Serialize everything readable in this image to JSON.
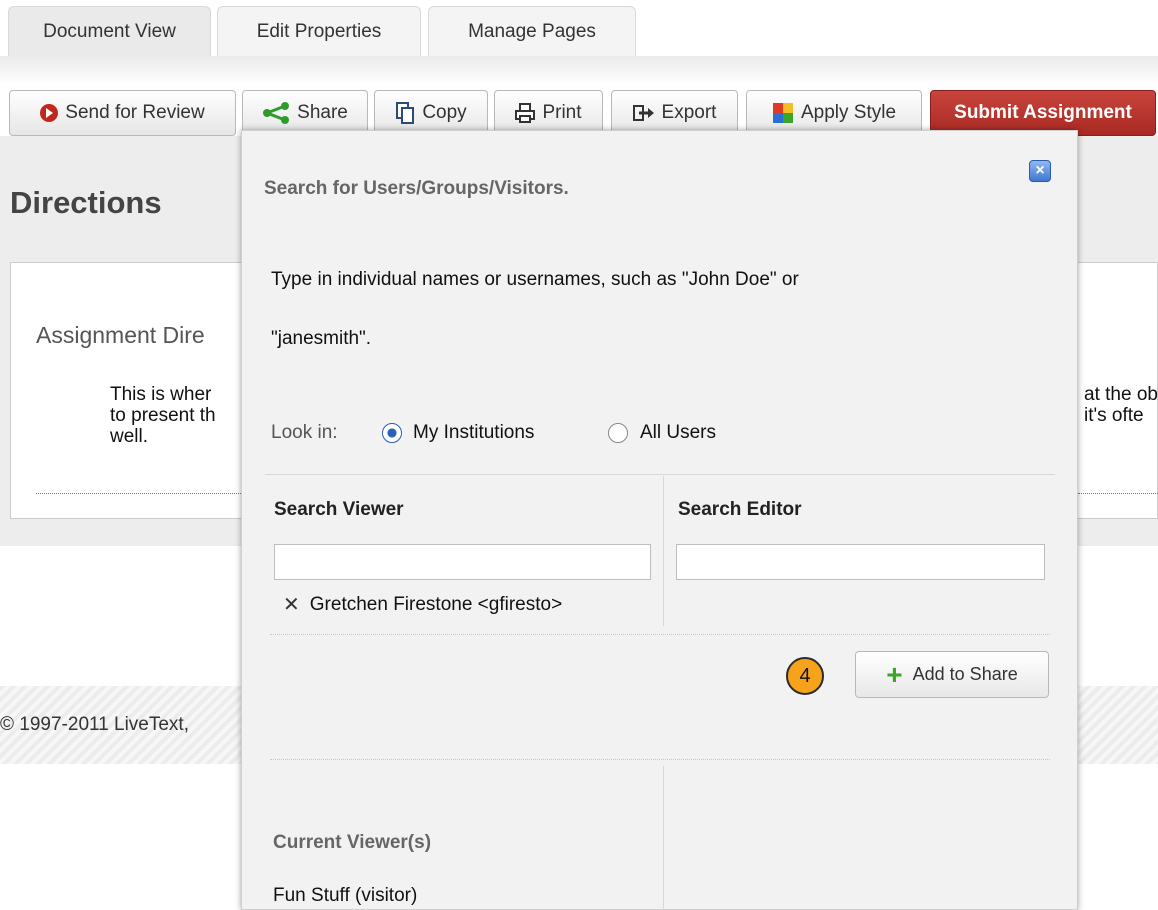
{
  "tabs": [
    "Document View",
    "Edit Properties",
    "Manage Pages"
  ],
  "toolbar": {
    "send_for_review": "Send for Review",
    "share": "Share",
    "copy": "Copy",
    "print": "Print",
    "export": "Export",
    "apply_style": "Apply Style",
    "submit_assignment": "Submit Assignment",
    "submit_color": "#b3352d"
  },
  "page": {
    "directions_title": "Directions",
    "assignment_heading": "Assignment Dire",
    "body_left": [
      "This is wher",
      "to present th",
      "well."
    ],
    "body_right": [
      "at the ob",
      "it's ofte"
    ],
    "footer": "© 1997-2011 LiveText,"
  },
  "share_popup": {
    "title": "Search for Users/Groups/Visitors.",
    "instructions_line1": "Type in individual names or usernames, such as \"John Doe\" or",
    "instructions_line2": "\"janesmith\".",
    "look_in_label": "Look in:",
    "options": [
      {
        "label": "My Institutions",
        "selected": true
      },
      {
        "label": "All Users",
        "selected": false
      }
    ],
    "search_viewer_label": "Search Viewer",
    "search_editor_label": "Search Editor",
    "search_viewer_value": "",
    "search_editor_value": "",
    "selected_user": "Gretchen Firestone <gfiresto>",
    "step_number": "4",
    "add_button": "Add to Share",
    "current_viewers_heading": "Current Viewer(s)",
    "current_viewers": [
      "Fun Stuff (visitor)"
    ]
  }
}
